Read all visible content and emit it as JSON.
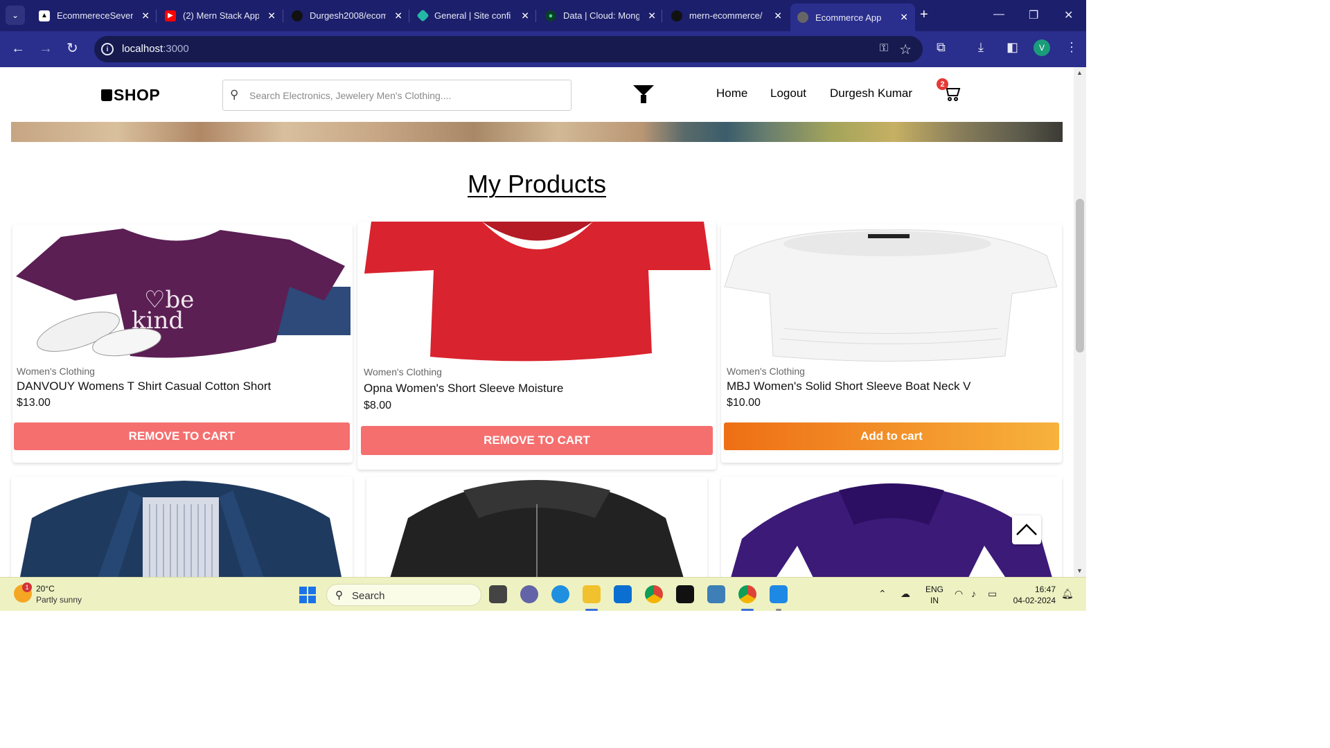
{
  "browser": {
    "tabs": [
      {
        "title": "EcommereceSever",
        "active": false,
        "icon": "vercel-icon"
      },
      {
        "title": "(2) Mern Stack App",
        "active": false,
        "icon": "youtube-icon"
      },
      {
        "title": "Durgesh2008/ecom",
        "active": false,
        "icon": "github-icon"
      },
      {
        "title": "General | Site confi",
        "active": false,
        "icon": "netlify-icon"
      },
      {
        "title": "Data | Cloud: Mong",
        "active": false,
        "icon": "mongodb-icon"
      },
      {
        "title": "mern-ecommerce/",
        "active": false,
        "icon": "github-icon"
      },
      {
        "title": "Ecommerce App",
        "active": true,
        "icon": "globe-icon"
      }
    ],
    "url_host": "localhost",
    "url_port": ":3000",
    "profile_initial": "V"
  },
  "header": {
    "logo": "SHOP",
    "search_placeholder": "Search Electronics, Jewelery Men's Clothing....",
    "nav": [
      "Home",
      "Logout",
      "Durgesh Kumar"
    ],
    "cart_count": "2"
  },
  "section_title": "My Products",
  "products": [
    {
      "category": "Women's Clothing",
      "name": "DANVOUY Womens T Shirt Casual Cotton Short",
      "price": "$13.00",
      "button": "REMOVE TO CART",
      "button_type": "remove",
      "color": "#5b1f54"
    },
    {
      "category": "Women's Clothing",
      "name": "Opna Women's Short Sleeve Moisture",
      "price": "$8.00",
      "button": "REMOVE TO CART",
      "button_type": "remove",
      "color": "#d9232e"
    },
    {
      "category": "Women's Clothing",
      "name": "MBJ Women's Solid Short Sleeve Boat Neck V",
      "price": "$10.00",
      "button": "Add to cart",
      "button_type": "add",
      "color": "#f4f4f4"
    },
    {
      "category": "",
      "name": "",
      "price": "",
      "button": "",
      "button_type": "",
      "color": "#1f3a5f"
    },
    {
      "category": "",
      "name": "",
      "price": "",
      "button": "",
      "button_type": "",
      "color": "#222222"
    },
    {
      "category": "",
      "name": "",
      "price": "",
      "button": "",
      "button_type": "",
      "color": "#3c1a78"
    }
  ],
  "taskbar": {
    "weather_temp": "20°C",
    "weather_desc": "Partly sunny",
    "weather_badge": "1",
    "search_label": "Search",
    "lang_line1": "ENG",
    "lang_line2": "IN",
    "time": "16:47",
    "date": "04-02-2024"
  }
}
